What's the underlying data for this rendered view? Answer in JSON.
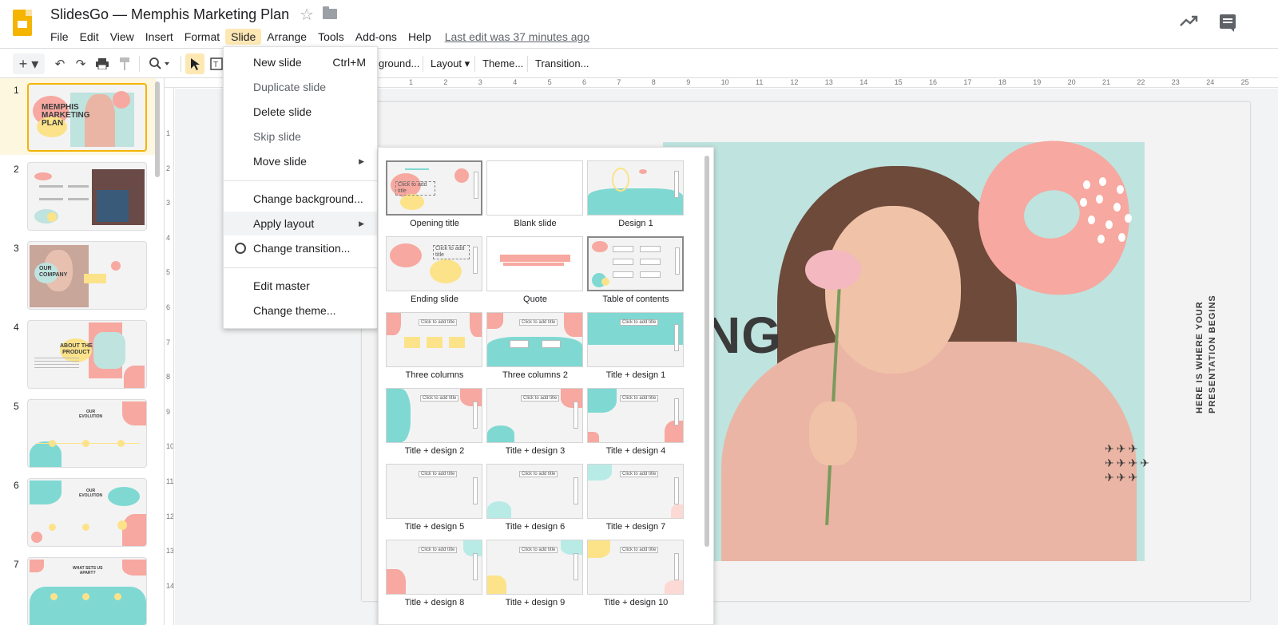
{
  "header": {
    "title": "SlidesGo — Memphis Marketing Plan",
    "menus": [
      "File",
      "Edit",
      "View",
      "Insert",
      "Format",
      "Slide",
      "Arrange",
      "Tools",
      "Add-ons",
      "Help"
    ],
    "active_menu": "Slide",
    "last_edit": "Last edit was 37 minutes ago",
    "icons": [
      "slides-logo-icon",
      "star-icon",
      "folder-icon",
      "trending-icon",
      "comment-icon"
    ]
  },
  "toolbar": {
    "background_label": "ground...",
    "layout_label": "Layout",
    "theme_label": "Theme...",
    "transition_label": "Transition...",
    "icons": [
      "add-icon",
      "undo-icon",
      "redo-icon",
      "print-icon",
      "paint-format-icon",
      "zoom-icon",
      "select-icon",
      "textbox-icon"
    ]
  },
  "filmstrip": {
    "slides": [
      {
        "num": "1",
        "title": "MEMPHIS\nMARKETING\nPLAN"
      },
      {
        "num": "2",
        "title": ""
      },
      {
        "num": "3",
        "title": "OUR\nCOMPANY"
      },
      {
        "num": "4",
        "title": "ABOUT THE\nPRODUCT"
      },
      {
        "num": "5",
        "title": "OUR\nEVOLUTION"
      },
      {
        "num": "6",
        "title": "OUR\nEVOLUTION"
      },
      {
        "num": "7",
        "title": "WHAT SETS US\nAPART?"
      }
    ]
  },
  "ruler": {
    "h": [
      "1",
      "2",
      "3",
      "4",
      "5",
      "6",
      "7",
      "8",
      "9",
      "10",
      "11",
      "12",
      "13",
      "14",
      "15",
      "16",
      "17",
      "18",
      "19",
      "20",
      "21",
      "22",
      "23",
      "24",
      "25"
    ],
    "v": [
      "1",
      "2",
      "3",
      "4",
      "5",
      "6",
      "7",
      "8",
      "9",
      "10",
      "11",
      "12",
      "13",
      "14"
    ]
  },
  "slide": {
    "partial_title": "NG",
    "tagline_1": "HERE IS WHERE YOUR",
    "tagline_2": "PRESENTATION BEGINS",
    "colors": {
      "mint": "#bfe3df",
      "pink": "#f7a8a0",
      "yellow": "#fce38a",
      "dark": "#3a3a3a"
    }
  },
  "slide_menu": {
    "new_slide": "New slide",
    "new_slide_shortcut": "Ctrl+M",
    "duplicate": "Duplicate slide",
    "delete": "Delete slide",
    "skip": "Skip slide",
    "move": "Move slide",
    "change_background": "Change background...",
    "apply_layout": "Apply layout",
    "change_transition": "Change transition...",
    "edit_master": "Edit master",
    "change_theme": "Change theme..."
  },
  "layouts": [
    "Opening title",
    "Blank slide",
    "Design 1",
    "Ending slide",
    "Quote",
    "Table of contents",
    "Three columns",
    "Three columns 2",
    "Title + design 1",
    "Title + design 2",
    "Title + design 3",
    "Title + design 4",
    "Title + design 5",
    "Title + design 6",
    "Title + design 7",
    "Title + design 8",
    "Title + design 9",
    "Title + design 10"
  ],
  "layout_thumb_text": {
    "click_title": "Click to add title",
    "small_title": "Click to add title"
  }
}
